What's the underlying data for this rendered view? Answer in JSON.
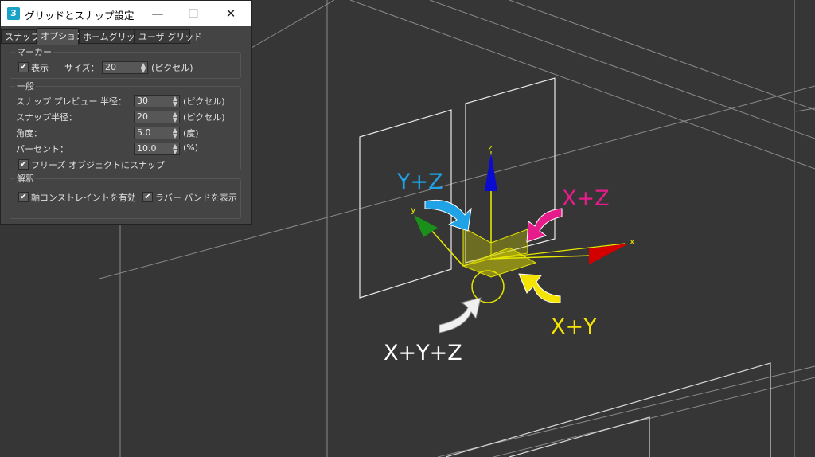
{
  "dialog": {
    "title": "グリッドとスナップ設定",
    "app_icon": "3",
    "controls": {
      "minimize": "—",
      "maximize": "☐",
      "close": "✕"
    },
    "tabs": [
      {
        "label": "スナップ",
        "active": false
      },
      {
        "label": "オプション",
        "active": true
      },
      {
        "label": "ホームグリッド",
        "active": false
      },
      {
        "label": "ユーザ グリッド",
        "active": false
      }
    ],
    "marker": {
      "title": "マーカー",
      "show_label": "表示",
      "show_checked": true,
      "size_label": "サイズ：",
      "size_value": "20",
      "size_unit": "(ピクセル)"
    },
    "general": {
      "title": "一般",
      "preview_radius_label": "スナップ プレビュー 半径：",
      "preview_radius_value": "30",
      "preview_radius_unit": "(ピクセル)",
      "snap_radius_label": "スナップ半径：",
      "snap_radius_value": "20",
      "snap_radius_unit": "(ピクセル)",
      "angle_label": "角度：",
      "angle_value": "5.0",
      "angle_unit": "(度)",
      "percent_label": "パーセント：",
      "percent_value": "10.0",
      "percent_unit": "(%)",
      "frozen_label": "フリーズ オブジェクトにスナップ",
      "frozen_checked": true
    },
    "translation": {
      "title": "解釈",
      "axis_label": "軸コンストレイントを有効",
      "axis_checked": true,
      "rubber_label": "ラバー バンドを表示",
      "rubber_checked": true
    }
  },
  "viewport": {
    "axis_labels": {
      "x": "x",
      "y": "y",
      "z": "z"
    },
    "annotations": {
      "yz": "Y+Z",
      "xz": "X+Z",
      "xy": "X+Y",
      "xyz": "X+Y+Z"
    },
    "colors": {
      "background": "#363636",
      "yz": "#1fa3e6",
      "xz": "#e61c8a",
      "xy": "#f5e400",
      "xyz": "#ffffff",
      "x_axis": "#d40000",
      "y_axis": "#1a8f1a",
      "z_axis": "#0a0ad0",
      "gizmo": "#e6e600"
    }
  }
}
